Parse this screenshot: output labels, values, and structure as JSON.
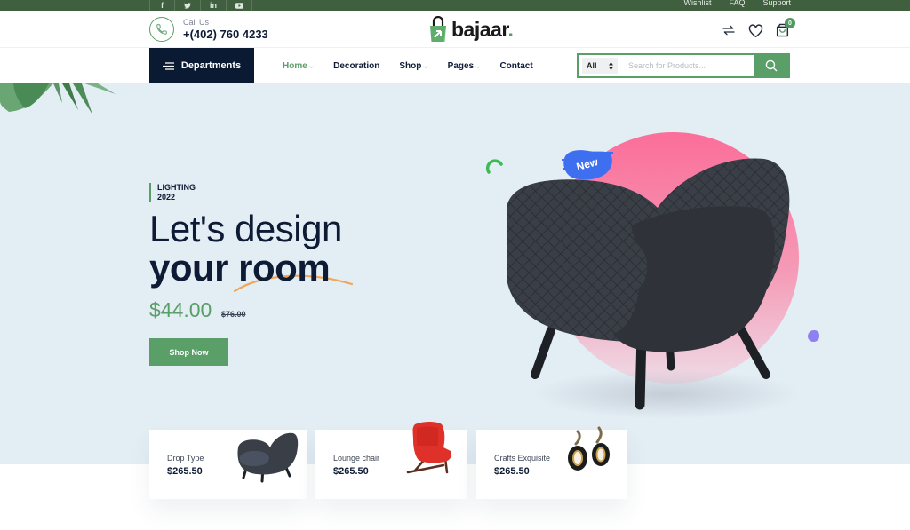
{
  "topbar": {
    "social": [
      {
        "icon": "facebook-icon",
        "glyph": "f"
      },
      {
        "icon": "twitter-icon",
        "glyph": "🐦"
      },
      {
        "icon": "linkedin-icon",
        "glyph": "in"
      },
      {
        "icon": "youtube-icon",
        "glyph": "▶"
      }
    ],
    "links": [
      "Wishlist",
      "FAQ",
      "Support"
    ]
  },
  "header": {
    "call_label": "Call Us",
    "phone": "+(402) 760 4233",
    "logo_text": "bajaar",
    "logo_dot": ".",
    "cart_count": "0"
  },
  "nav": {
    "departments_label": "Departments",
    "menu": [
      {
        "label": "Home",
        "dropdown": true,
        "active": true
      },
      {
        "label": "Decoration",
        "dropdown": false,
        "active": false
      },
      {
        "label": "Shop",
        "dropdown": true,
        "active": false
      },
      {
        "label": "Pages",
        "dropdown": true,
        "active": false
      },
      {
        "label": "Contact",
        "dropdown": false,
        "active": false
      }
    ],
    "chevron": "⌵",
    "search": {
      "category": "All",
      "placeholder": "Search for Products..."
    }
  },
  "hero": {
    "tag_line1": "LIGHTING",
    "tag_line2": "2022",
    "title_light": "Let's design",
    "title_bold": "your room",
    "price": "$44.00",
    "old_price": "$76.00",
    "cta": "Shop Now",
    "badge": "New"
  },
  "products": [
    {
      "name": "Drop Type",
      "price": "$265.50"
    },
    {
      "name": "Lounge chair",
      "price": "$265.50"
    },
    {
      "name": "Crafts Exquisite",
      "price": "$265.50"
    }
  ],
  "colors": {
    "brand_green": "#5a9e68",
    "topbar_green": "#3f5f3f",
    "navy": "#0b1a33",
    "hero_bg": "#e3edf4",
    "pink": "#fb6e9a",
    "badge_blue": "#3d6ff0"
  }
}
